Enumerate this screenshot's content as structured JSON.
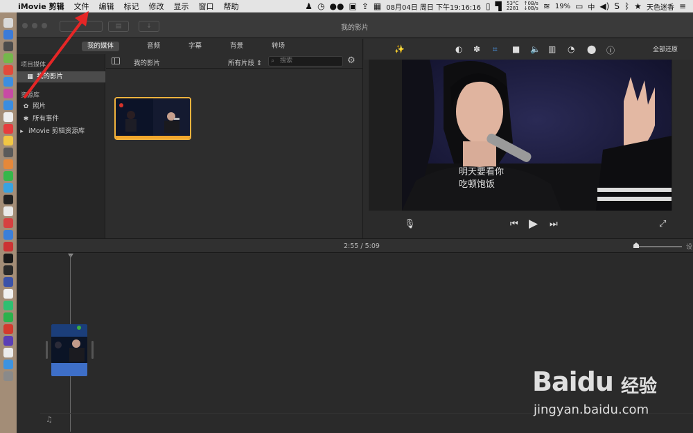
{
  "menubar": {
    "app_name": "iMovie 剪辑",
    "items": [
      "文件",
      "编辑",
      "标记",
      "修改",
      "显示",
      "窗口",
      "帮助"
    ],
    "clock": "08月04日 周日 下午19:16:16",
    "temp": "53°C",
    "fan": "2281",
    "net_up": "0B/s",
    "net_down": "0B/s",
    "battery": "19%",
    "input_method": "中",
    "user": "天色迷香"
  },
  "window": {
    "title": "我的影片"
  },
  "browser": {
    "tabs": [
      "我的媒体",
      "音频",
      "字幕",
      "背景",
      "转场"
    ],
    "sidebar": {
      "project_media_header": "项目媒体",
      "project_item": "我的影片",
      "libraries_header": "资源库",
      "photos": "照片",
      "all_events": "所有事件",
      "library": "iMovie 剪辑资源库"
    },
    "content_title": "我的影片",
    "filter": "所有片段",
    "search_placeholder": "搜索"
  },
  "viewer": {
    "reset_all": "全部还原",
    "subtitle_line1": "明天要看你",
    "subtitle_line2": "吃顿饱饭"
  },
  "timeline": {
    "current_time": "2:55",
    "separator": "/",
    "total_time": "5:09",
    "zoom_label": "设"
  },
  "watermark": {
    "brand": "Baidu",
    "brand_cn": "经验",
    "url": "jingyan.baidu.com"
  }
}
